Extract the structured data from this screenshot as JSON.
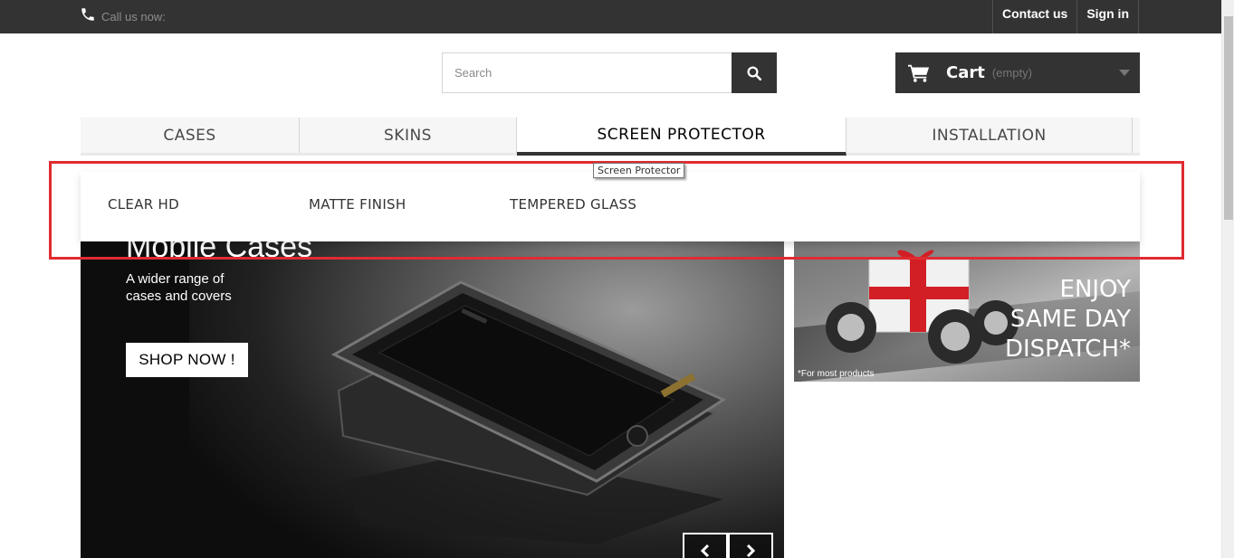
{
  "topbar": {
    "call_label": "Call us now:",
    "links": [
      "Contact us",
      "Sign in"
    ]
  },
  "search": {
    "placeholder": "Search"
  },
  "cart": {
    "label": "Cart",
    "status": "(empty)"
  },
  "menu": {
    "tabs": [
      {
        "label": "CASES"
      },
      {
        "label": "SKINS"
      },
      {
        "label": "SCREEN PROTECTOR"
      },
      {
        "label": "INSTALLATION"
      }
    ],
    "active_tab": "SCREEN PROTECTOR",
    "tooltip": "Screen Protector"
  },
  "submenu": {
    "items": [
      {
        "label": "CLEAR HD"
      },
      {
        "label": "MATTE FINISH"
      },
      {
        "label": "TEMPERED GLASS"
      }
    ]
  },
  "slider": {
    "title": "Mobile Cases",
    "subtitle": "A wider range of cases and covers",
    "button": "SHOP NOW !"
  },
  "promo": {
    "lines": [
      "ENJOY",
      "SAME DAY",
      "DISPATCH*"
    ],
    "note": "*For most products"
  },
  "colors": {
    "topbar_bg": "#333333",
    "highlight": "#e02b31",
    "cart_bg": "#333333"
  }
}
